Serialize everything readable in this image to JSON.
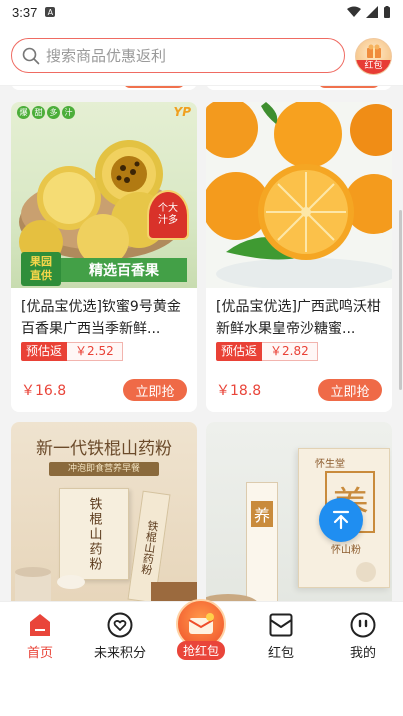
{
  "status_bar": {
    "time": "3:37",
    "notif": "A"
  },
  "search": {
    "placeholder": "搜索商品优惠返利"
  },
  "redpacket": {
    "label": "红包"
  },
  "products": [
    {
      "title": "[优品宝优选]钦蜜9号黄金百香果广西当季新鲜...",
      "rebate_label": "预估返",
      "rebate_value": "￥2.52",
      "price": "￥16.8",
      "buy_label": "立即抢",
      "image": {
        "corner_tags": [
          "爆",
          "甜",
          "多",
          "汁"
        ],
        "brand_mark": "YP",
        "ribbon": "个大\n汁多",
        "ribbon_line1": "个大",
        "ribbon_line2": "汁多",
        "green_tag_line1": "果园",
        "green_tag_line2": "直供",
        "banner": "精选百香果"
      }
    },
    {
      "title": "[优品宝优选]广西武鸣沃柑新鲜水果皇帝沙糖蜜...",
      "rebate_label": "预估返",
      "rebate_value": "￥2.82",
      "price": "￥18.8",
      "buy_label": "立即抢",
      "image": {}
    },
    {
      "title": "",
      "image": {
        "headline": "新一代铁棍山药粉",
        "subline": "冲泡即食营养早餐",
        "box_text": "铁棍山药粉",
        "stick_text": "铁棍山药粉"
      }
    },
    {
      "title": "",
      "image": {
        "brand": "怀生堂",
        "big_char": "养",
        "box_sub": "怀山粉",
        "stick_char": "养"
      }
    }
  ],
  "nav": {
    "home": "首页",
    "points": "未来积分",
    "grab": "抢红包",
    "redpacket": "红包",
    "mine": "我的"
  },
  "colors": {
    "accent": "#e9453a",
    "button": "#ef6a47",
    "fab": "#1f8ef1"
  }
}
